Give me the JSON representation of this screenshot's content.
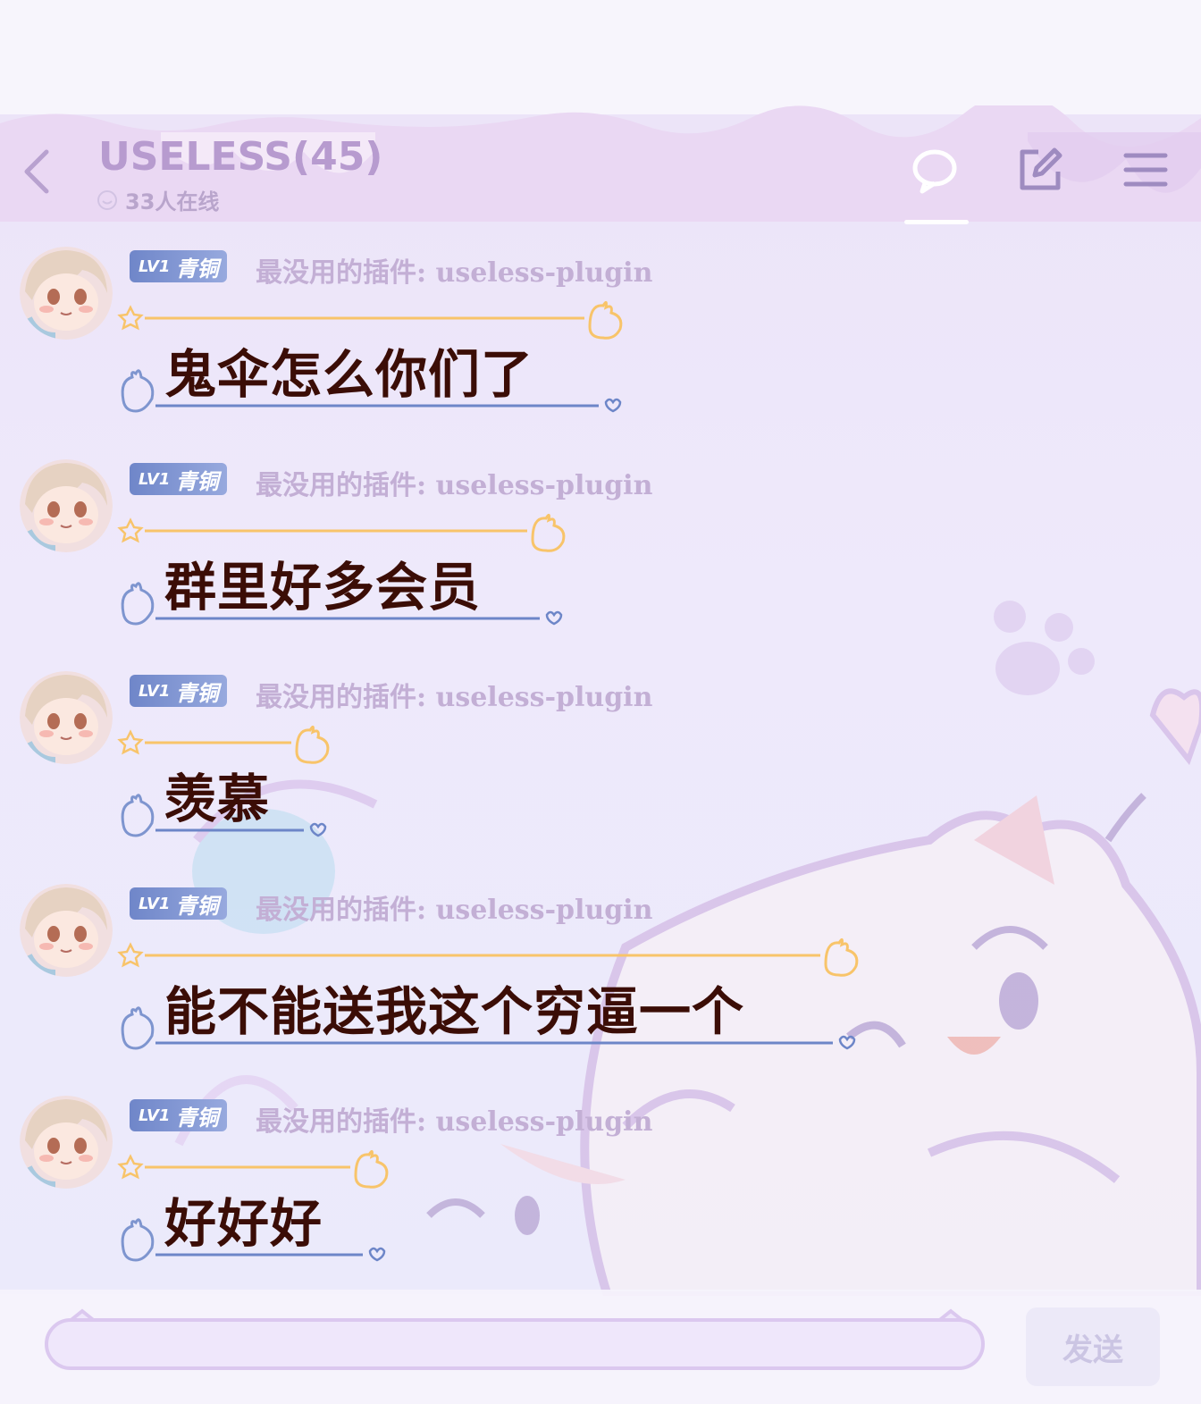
{
  "header": {
    "title": "USELESS(45)",
    "online": "33人在线"
  },
  "badge": {
    "level": "LV1",
    "rank": "青铜"
  },
  "messages": [
    {
      "sender": "最没用的插件: useless-plugin",
      "text": "鬼伞怎么你们了"
    },
    {
      "sender": "最没用的插件: useless-plugin",
      "text": "群里好多会员"
    },
    {
      "sender": "最没用的插件: useless-plugin",
      "text": "羡慕"
    },
    {
      "sender": "最没用的插件: useless-plugin",
      "text": "能不能送我这个穷逼一个"
    },
    {
      "sender": "最没用的插件: useless-plugin",
      "text": "好好好"
    }
  ],
  "footer": {
    "send_label": "发送",
    "input_value": ""
  },
  "colors": {
    "title": "#b79bcf",
    "badge": "#7b8fd0",
    "sender": "#c3afd5",
    "message": "#3b0d06",
    "orange_line": "#f8c46a",
    "blue_line": "#6d86c8"
  }
}
